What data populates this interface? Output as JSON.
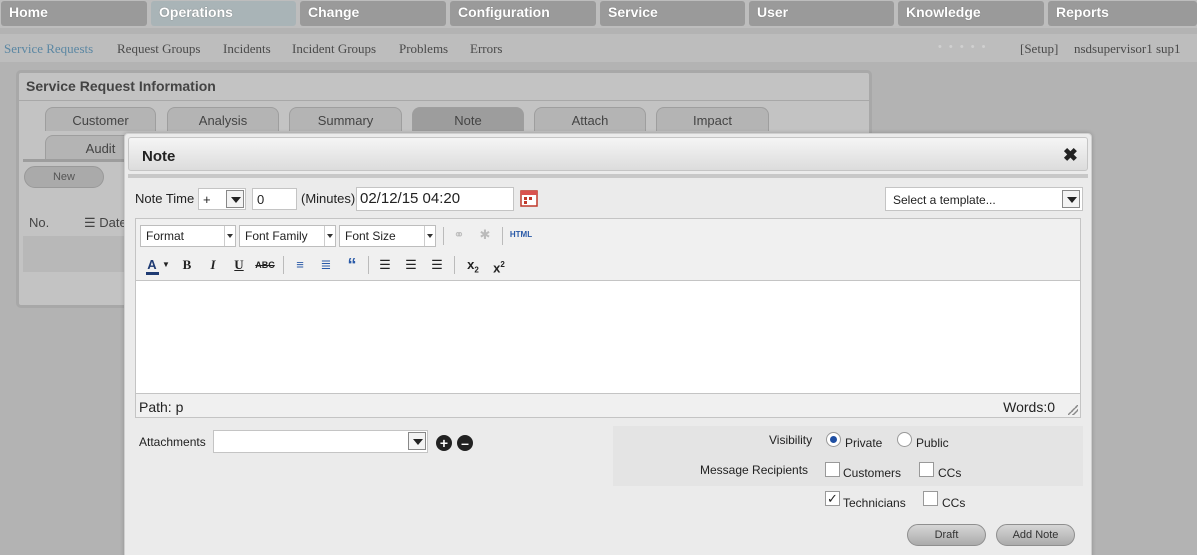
{
  "topnav": [
    "Home",
    "Operations",
    "Change",
    "Configuration",
    "Service",
    "User",
    "Knowledge",
    "Reports"
  ],
  "subnav": [
    "Service Requests",
    "Request Groups",
    "Incidents",
    "Incident Groups",
    "Problems",
    "Errors"
  ],
  "header_right": {
    "dots": "• • • • •",
    "setup": "[Setup]",
    "user": "nsdsupervisor1 sup1"
  },
  "sr_panel": {
    "title": "Service Request Information",
    "tabs": [
      "Customer",
      "Analysis",
      "Summary",
      "Note",
      "Attach",
      "Impact",
      "Audit"
    ],
    "active_tab": "Note",
    "new_button": "New",
    "col_no": "No.",
    "col_date": "Date"
  },
  "dialog": {
    "title": "Note",
    "note_time_label": "Note Time",
    "sign": "+",
    "minutes_value": "0",
    "minutes_label": "(Minutes)",
    "datetime": "02/12/15 04:20",
    "template_placeholder": "Select a template...",
    "toolbar": {
      "format": "Format",
      "font_family": "Font Family",
      "font_size": "Font Size",
      "html": "HTML"
    },
    "path_label": "Path: p",
    "words_label": "Words:0",
    "attachments_label": "Attachments",
    "visibility_label": "Visibility",
    "private_label": "Private",
    "public_label": "Public",
    "recipients_label": "Message Recipients",
    "customers_label": "Customers",
    "ccs_label": "CCs",
    "technicians_label": "Technicians",
    "draft_button": "Draft",
    "add_note_button": "Add Note"
  },
  "colors": {
    "nav_tab": "#9a9a9a",
    "nav_active": "#a9b4b7",
    "subnav_active": "#5b87a3",
    "radio_selected": "#1f4fa3"
  }
}
